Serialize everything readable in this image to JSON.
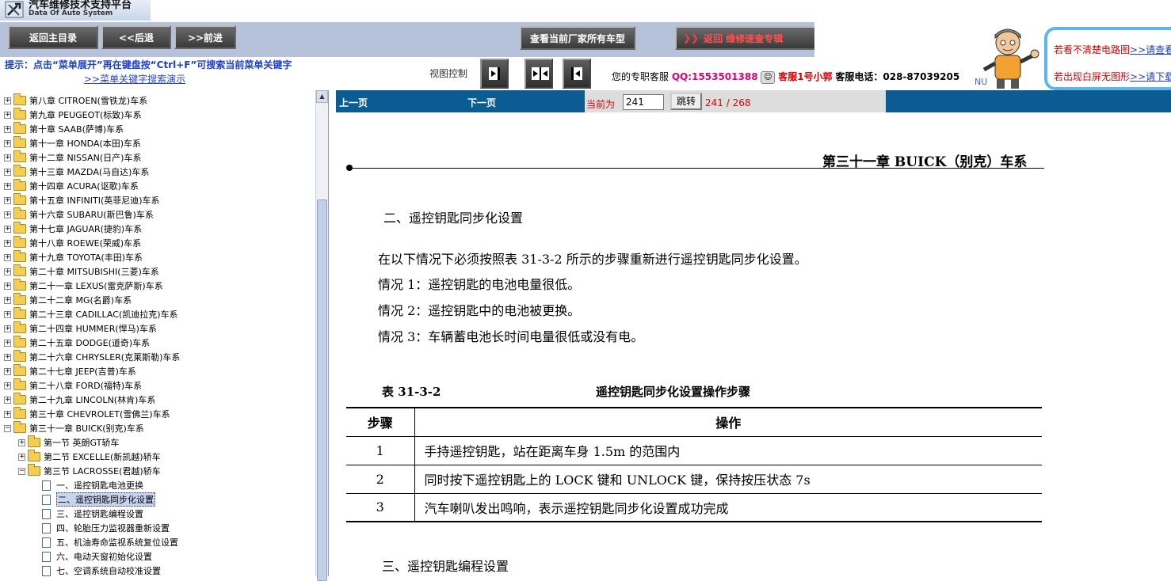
{
  "app": {
    "title": "汽车维修技术支持平台",
    "subtitle": "Data Of Auto System"
  },
  "toolbar": {
    "home_label": "返回主目录",
    "back_label": "<<后退",
    "forward_label": ">>前进",
    "all_models_label": "查看当前厂家所有车型",
    "return_label": "返回 维修速查专辑"
  },
  "tip": {
    "text": "提示：点击“菜单展开”再在键盘按“Ctrl+F”可搜索当前菜单关键字",
    "link": ">>菜单关键字搜索演示"
  },
  "view_control": {
    "label": "视图控制"
  },
  "service": {
    "prefix": "您的专职客服",
    "qq": "QQ:1553501388",
    "agent": "客服1号小郭",
    "phone": "客服电话：028-87039205"
  },
  "promo": {
    "line1_text": "若看不清楚电路图",
    "line1_link": ">>请查看",
    "line2_text": "若出现白屏无图形",
    "line2_link": ">>请下载"
  },
  "nu_label": "NU",
  "tree": {
    "items": [
      {
        "label": "第八章  CITROEN(雪铁龙)车系"
      },
      {
        "label": "第九章  PEUGEOT(标致)车系"
      },
      {
        "label": "第十章  SAAB(萨博)车系"
      },
      {
        "label": "第十一章  HONDA(本田)车系"
      },
      {
        "label": "第十二章  NISSAN(日产)车系"
      },
      {
        "label": "第十三章  MAZDA(马自达)车系"
      },
      {
        "label": "第十四章  ACURA(讴歌)车系"
      },
      {
        "label": "第十五章  INFINITI(英菲尼迪)车系"
      },
      {
        "label": "第十六章  SUBARU(斯巴鲁)车系"
      },
      {
        "label": "第十七章  JAGUAR(捷豹)车系"
      },
      {
        "label": "第十八章  ROEWE(荣威)车系"
      },
      {
        "label": "第十九章  TOYOTA(丰田)车系"
      },
      {
        "label": "第二十章  MITSUBISHI(三菱)车系"
      },
      {
        "label": "第二十一章  LEXUS(雷克萨斯)车系"
      },
      {
        "label": "第二十二章  MG(名爵)车系"
      },
      {
        "label": "第二十三章  CADILLAC(凯迪拉克)车系"
      },
      {
        "label": "第二十四章  HUMMER(悍马)车系"
      },
      {
        "label": "第二十五章  DODGE(道奇)车系"
      },
      {
        "label": "第二十六章  CHRYSLER(克莱斯勒)车系"
      },
      {
        "label": "第二十七章  JEEP(吉普)车系"
      },
      {
        "label": "第二十八章  FORD(福特)车系"
      },
      {
        "label": "第二十九章  LINCOLN(林肯)车系"
      },
      {
        "label": "第三十章  CHEVROLET(雪佛兰)车系"
      },
      {
        "label": "第三十一章  BUICK(别克)车系"
      },
      {
        "label": "第一节  英朗GT轿车"
      },
      {
        "label": "第二节  EXCELLE(新凯越)轿车"
      },
      {
        "label": "第三节  LACROSSE(君越)轿车"
      },
      {
        "label": "一、遥控钥匙电池更换"
      },
      {
        "label": "二、遥控钥匙同步化设置"
      },
      {
        "label": "三、遥控钥匙编程设置"
      },
      {
        "label": "四、轮胎压力监视器重新设置"
      },
      {
        "label": "五、机油寿命监视系统复位设置"
      },
      {
        "label": "六、电动天窗初始化设置"
      },
      {
        "label": "七、空调系统自动校准设置"
      }
    ]
  },
  "pager": {
    "prev": "上一页",
    "next": "下一页",
    "current_label": "当前为",
    "current_value": "241",
    "go_label": "跳转",
    "position": "241 / 268"
  },
  "document": {
    "chapter_header": "第三十一章    BUICK（别克）车系",
    "section2_title": "二、遥控钥匙同步化设置",
    "paragraphs": [
      "在以下情况下必须按照表 31-3-2 所示的步骤重新进行遥控钥匙同步化设置。",
      "情况 1：遥控钥匙的电池电量很低。",
      "情况 2：遥控钥匙中的电池被更换。",
      "情况 3：车辆蓄电池长时间电量很低或没有电。"
    ],
    "table_caption": "表 31-3-2",
    "table_title": "遥控钥匙同步化设置操作步骤",
    "table_headers": [
      "步骤",
      "操作"
    ],
    "table_rows": [
      {
        "step": "1",
        "op": "手持遥控钥匙，站在距离车身 1.5m 的范围内"
      },
      {
        "step": "2",
        "op": "同时按下遥控钥匙上的 LOCK 键和 UNLOCK 键，保持按压状态 7s"
      },
      {
        "step": "3",
        "op": "汽车喇叭发出鸣响，表示遥控钥匙同步化设置成功完成"
      }
    ],
    "section3_title": "三、遥控钥匙编程设置"
  },
  "colors": {
    "nav_band": "#b6c2da",
    "pager_bar": "#0b5c92",
    "tip_text": "#1f3fd0",
    "alert_red": "#e00000"
  }
}
